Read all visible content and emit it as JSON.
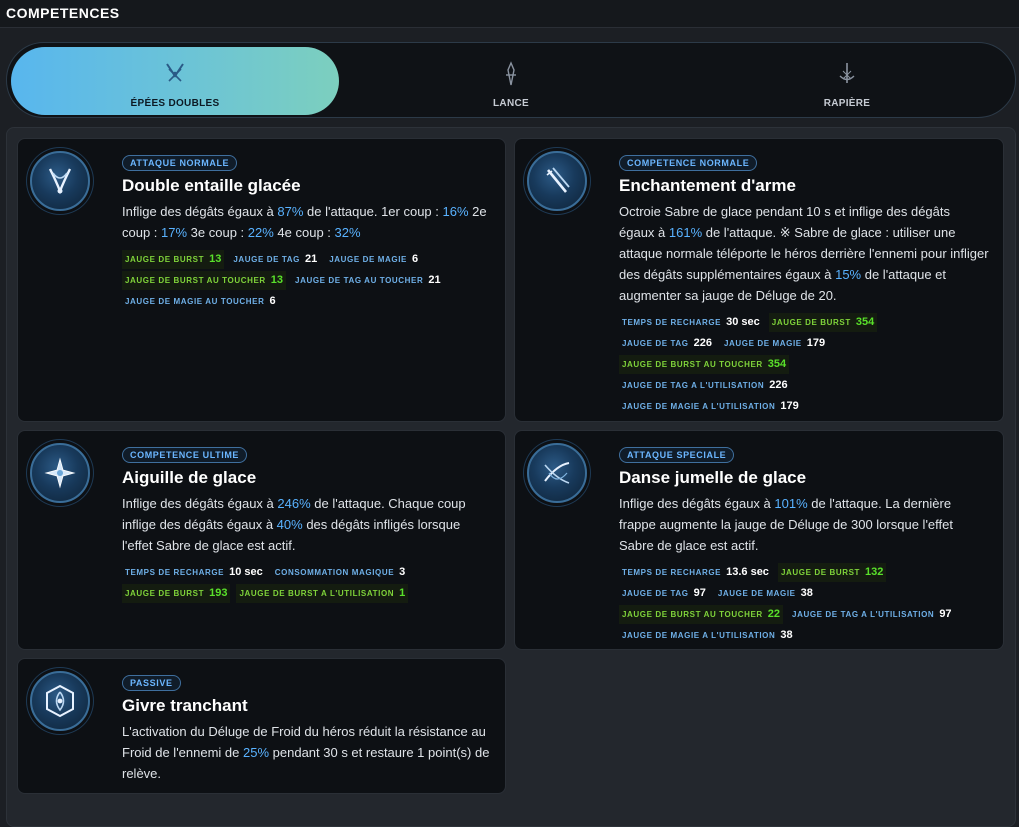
{
  "header": {
    "title": "COMPETENCES"
  },
  "weapons": [
    {
      "label": "ÉPÉES DOUBLES",
      "active": true
    },
    {
      "label": "LANCE",
      "active": false
    },
    {
      "label": "RAPIÈRE",
      "active": false
    }
  ],
  "skills": [
    {
      "badge": "ATTAQUE NORMALE",
      "title": "Double entaille glacée",
      "desc": [
        {
          "t": "Inflige des dégâts égaux à "
        },
        {
          "t": "87%",
          "h": true
        },
        {
          "t": " de l'attaque. 1er coup : "
        },
        {
          "t": "16%",
          "h": true
        },
        {
          "t": " 2e coup : "
        },
        {
          "t": "17%",
          "h": true
        },
        {
          "t": " 3e coup : "
        },
        {
          "t": "22%",
          "h": true
        },
        {
          "t": " 4e coup : "
        },
        {
          "t": "32%",
          "h": true
        }
      ],
      "stats": [
        [
          {
            "k": "JAUGE DE BURST",
            "v": "13",
            "burst": true
          },
          {
            "k": "JAUGE DE TAG",
            "v": "21"
          },
          {
            "k": "JAUGE DE MAGIE",
            "v": "6"
          }
        ],
        [
          {
            "k": "JAUGE DE BURST AU TOUCHER",
            "v": "13",
            "burst": true
          },
          {
            "k": "JAUGE DE TAG AU TOUCHER",
            "v": "21"
          }
        ],
        [
          {
            "k": "JAUGE DE MAGIE AU TOUCHER",
            "v": "6"
          }
        ]
      ]
    },
    {
      "badge": "COMPETENCE NORMALE",
      "title": "Enchantement d'arme",
      "desc": [
        {
          "t": "Octroie Sabre de glace pendant 10 s et inflige des dégâts égaux à "
        },
        {
          "t": "161%",
          "h": true
        },
        {
          "t": " de l'attaque. ※ Sabre de glace : utiliser une attaque normale téléporte le héros derrière l'ennemi pour infliger des dégâts supplémentaires égaux à "
        },
        {
          "t": "15%",
          "h": true
        },
        {
          "t": " de l'attaque et augmenter sa jauge de Déluge de 20."
        }
      ],
      "stats": [
        [
          {
            "k": "TEMPS DE RECHARGE",
            "v": "30 sec"
          },
          {
            "k": "JAUGE DE BURST",
            "v": "354",
            "burst": true
          }
        ],
        [
          {
            "k": "JAUGE DE TAG",
            "v": "226"
          },
          {
            "k": "JAUGE DE MAGIE",
            "v": "179"
          }
        ],
        [
          {
            "k": "JAUGE DE BURST AU TOUCHER",
            "v": "354",
            "burst": true
          }
        ],
        [
          {
            "k": "JAUGE DE TAG A L'UTILISATION",
            "v": "226"
          }
        ],
        [
          {
            "k": "JAUGE DE MAGIE A L'UTILISATION",
            "v": "179"
          }
        ]
      ]
    },
    {
      "badge": "COMPETENCE ULTIME",
      "title": "Aiguille de glace",
      "desc": [
        {
          "t": "Inflige des dégâts égaux à "
        },
        {
          "t": "246%",
          "h": true
        },
        {
          "t": " de l'attaque. Chaque coup inflige des dégâts égaux à "
        },
        {
          "t": "40%",
          "h": true
        },
        {
          "t": " des dégâts infligés lorsque l'effet Sabre de glace est actif."
        }
      ],
      "stats": [
        [
          {
            "k": "TEMPS DE RECHARGE",
            "v": "10 sec"
          },
          {
            "k": "CONSOMMATION MAGIQUE",
            "v": "3"
          }
        ],
        [
          {
            "k": "JAUGE DE BURST",
            "v": "193",
            "burst": true
          },
          {
            "k": "JAUGE DE BURST A L'UTILISATION",
            "v": "1",
            "burst": true
          }
        ]
      ]
    },
    {
      "badge": "ATTAQUE SPECIALE",
      "title": "Danse jumelle de glace",
      "desc": [
        {
          "t": "Inflige des dégâts égaux à "
        },
        {
          "t": "101%",
          "h": true
        },
        {
          "t": " de l'attaque. La dernière frappe augmente la jauge de Déluge de 300 lorsque l'effet Sabre de glace est actif."
        }
      ],
      "stats": [
        [
          {
            "k": "TEMPS DE RECHARGE",
            "v": "13.6 sec"
          },
          {
            "k": "JAUGE DE BURST",
            "v": "132",
            "burst": true
          }
        ],
        [
          {
            "k": "JAUGE DE TAG",
            "v": "97"
          },
          {
            "k": "JAUGE DE MAGIE",
            "v": "38"
          }
        ],
        [
          {
            "k": "JAUGE DE BURST AU TOUCHER",
            "v": "22",
            "burst": true
          },
          {
            "k": "JAUGE DE TAG A L'UTILISATION",
            "v": "97"
          }
        ],
        [
          {
            "k": "JAUGE DE MAGIE A L'UTILISATION",
            "v": "38"
          }
        ]
      ]
    },
    {
      "badge": "PASSIVE",
      "title": "Givre tranchant",
      "desc": [
        {
          "t": "L'activation du Déluge de Froid du héros réduit la résistance au Froid de l'ennemi de "
        },
        {
          "t": "25%",
          "h": true
        },
        {
          "t": " pendant 30 s et restaure 1 point(s) de relève."
        }
      ],
      "stats": []
    }
  ],
  "icons": [
    "dual-swords-icon",
    "lance-icon",
    "rapier-icon",
    "crossed-blades-icon",
    "sword-pair-icon",
    "ice-flower-icon",
    "swirl-slash-icon",
    "hex-shield-icon"
  ],
  "colors": {
    "accent": "#59b2ff",
    "burst": "#59e02a",
    "tab_active_start": "#58b6ee",
    "tab_active_end": "#7ccfbe"
  }
}
